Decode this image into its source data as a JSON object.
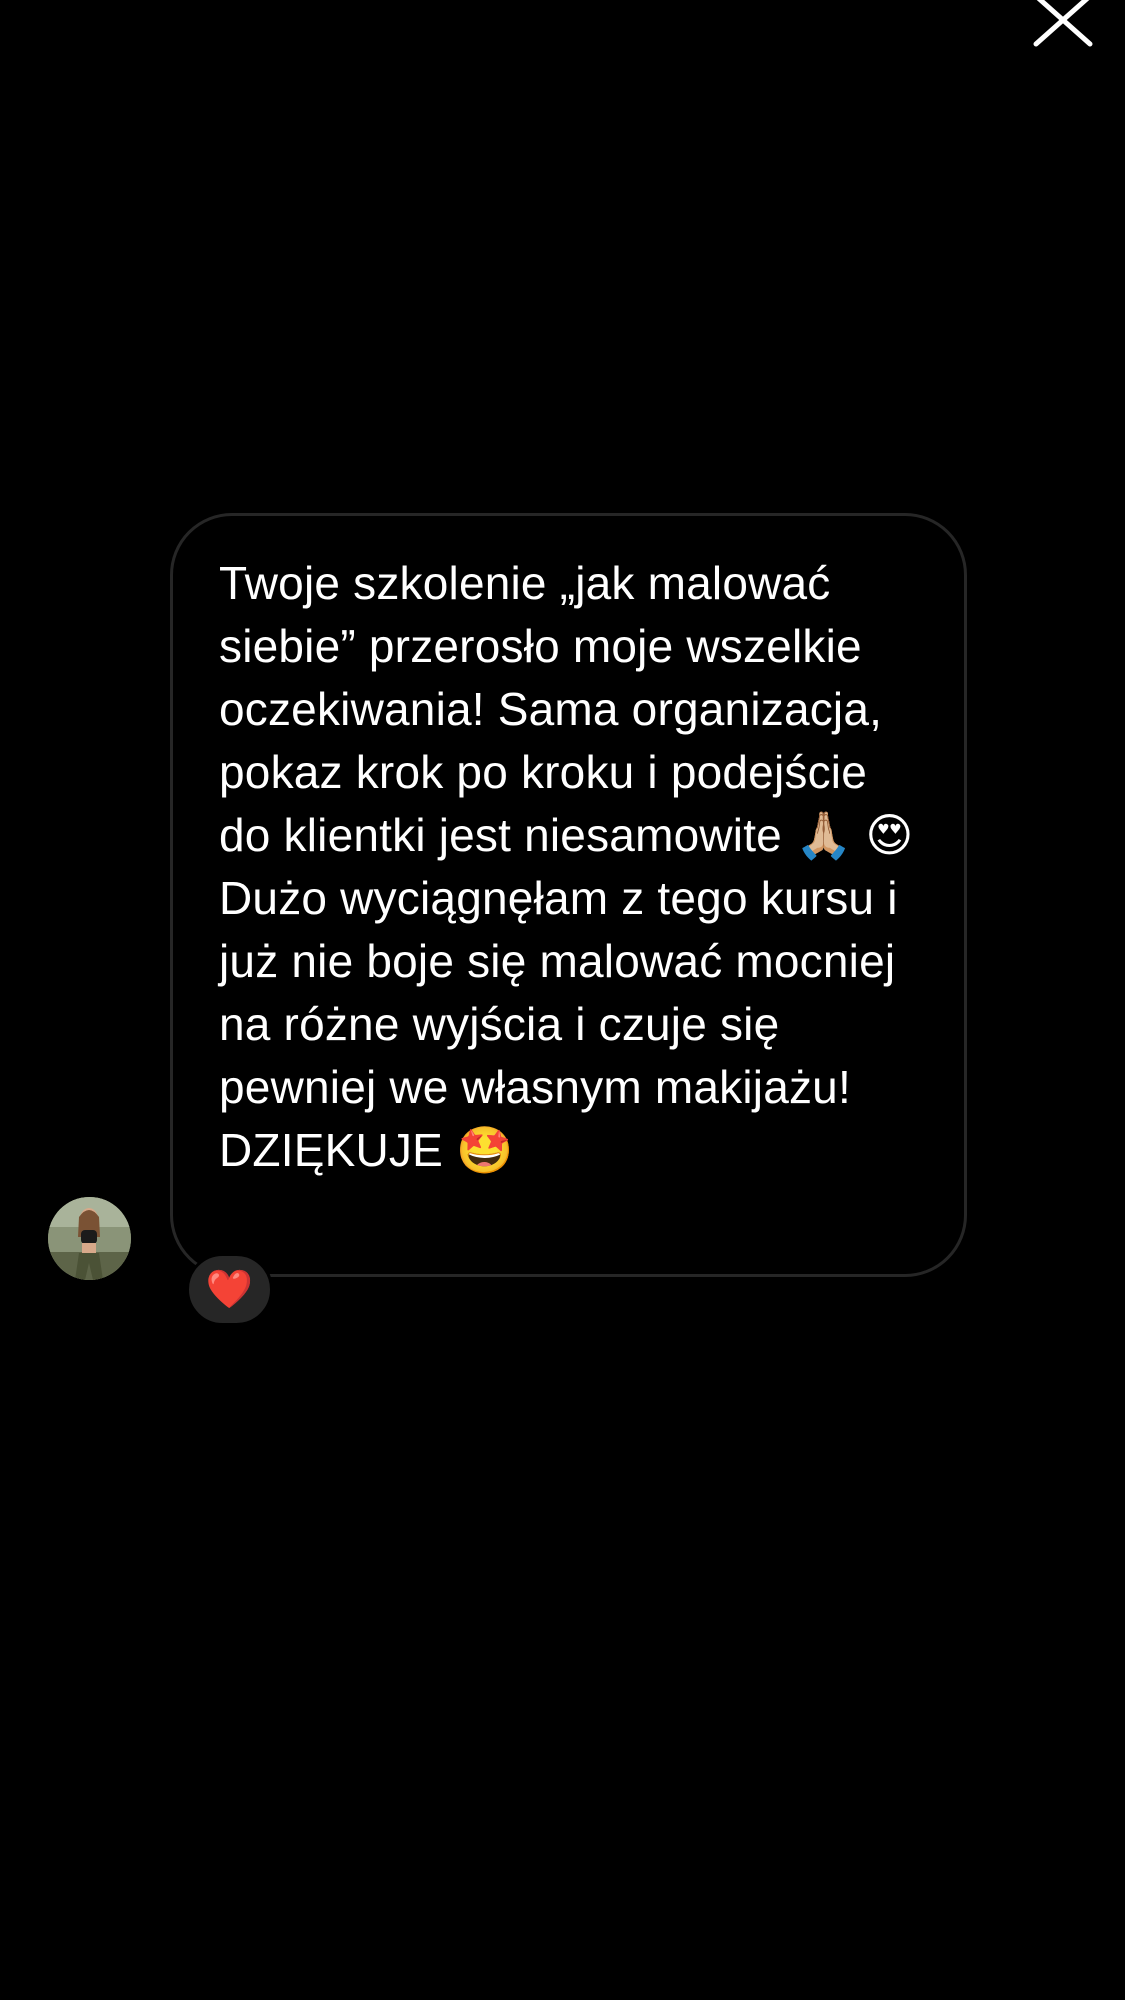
{
  "message": {
    "text": "Twoje szkolenie „jak malować siebie” przerosło moje wszelkie oczekiwania! Sama organizacja, pokaz krok po kroku i podejście do klientki jest niesamowite 🙏🏼 😍  Dużo wyciągnęłam z tego kursu i już nie boje się malować mocniej na różne wyjścia i czuje się pewniej we własnym makijażu!\nDZIĘKUJE 🤩"
  },
  "reaction": {
    "emoji": "❤️"
  },
  "icons": {
    "close": "close-icon",
    "avatar": "profile-avatar"
  },
  "colors": {
    "background": "#000000",
    "bubble_border": "#262626",
    "reaction_background": "#262626",
    "text": "#ffffff"
  }
}
